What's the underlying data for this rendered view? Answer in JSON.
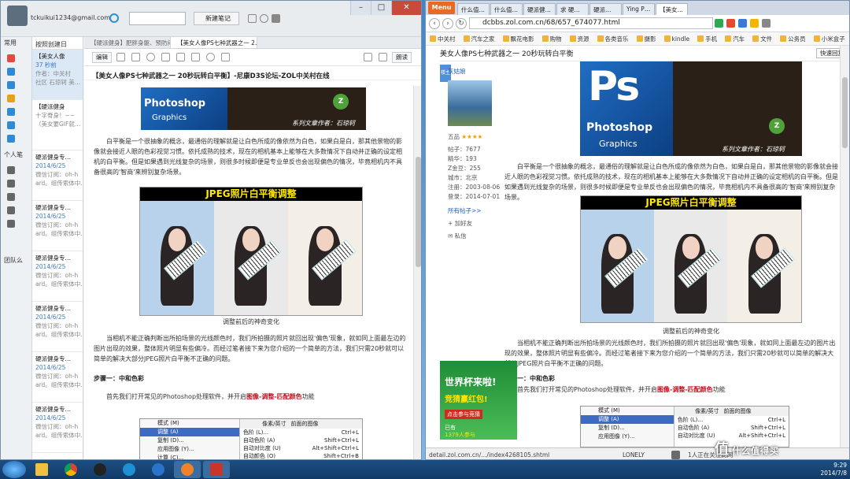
{
  "note_app": {
    "account": "tckuikui1234@gmail.com",
    "new_note_label": "新建笔记",
    "sidebar_labels": [
      "常用",
      "个人笔",
      "团队么"
    ],
    "list_header": "按照创建日",
    "list_items": [
      {
        "title": "【美女人像",
        "date": "37 秒前",
        "snip1": "作者：中关村",
        "snip2": "社区 石琼轲 美…"
      },
      {
        "title": "【硬派健身",
        "date": "十字脊身！~~",
        "snip1": "（美女要GIF就…",
        "snip2": ""
      },
      {
        "title": "硬派健身专…",
        "date": "2014/6/25",
        "snip1": "微信订阅：oh-h",
        "snip2": "ard。组传索体中…"
      },
      {
        "title": "硬派健身专…",
        "date": "2014/6/25",
        "snip1": "微信订阅：oh-h",
        "snip2": "ard。组传索体中…"
      },
      {
        "title": "硬派健身专…",
        "date": "2014/6/25",
        "snip1": "微信订阅：oh-h",
        "snip2": "ard。组传索体中…"
      },
      {
        "title": "硬派健身专…",
        "date": "2014/6/25",
        "snip1": "微信订阅：oh-h",
        "snip2": "ard。组传索体中…"
      },
      {
        "title": "硬派健身专…",
        "date": "2014/6/25",
        "snip1": "微信订阅：oh-h",
        "snip2": "ard。组传索体中…"
      },
      {
        "title": "硬派健身专…",
        "date": "2014/6/25",
        "snip1": "微信订阅：oh-h",
        "snip2": "ard。组传索体中…"
      }
    ],
    "tabs": [
      "【硬派健身】肥胖身躯、预防闷…",
      "【美女人像PS七种武器之一 2…"
    ],
    "toolbar": {
      "edit": "编辑",
      "read": "朗读"
    },
    "note_title": "【美女人像PS七种武器之一 20秒玩转白平衡】-尼康D3S论坛-ZOL中关村在线",
    "article": {
      "banner_caption": "系列文章作者：石琼轲",
      "banner_ps": "Photoshop",
      "banner_graphics": "Graphics",
      "para1": "白平衡是一个很抽象的概念，最通俗的理解就是让白色所成的像依然为白色，如果白是白，那其他景物的影像就会接近人眼的色彩视觉习惯。依托成熟的技术，现在的相机基本上能够在大多数情况下自动并正确的设定相机的白平衡。但是如果遇到光线复杂的场景，则很多时候即便是专业单反也会出现偏色的情况，毕竟相机内不具备很高的'智商'来辨别复杂场景。",
      "jpeg_title": "JPEG照片白平衡调整",
      "photo_caption": "调整前后的神奇变化",
      "para2": "当相机不能正确判断出所拍场景的光线颜色时，我们所拍摄的照片就回出现'偏色'现象，就如同上面最左边的图片出现的效果，整体照片明显有些偏冷。而经过笔者接下来为您介绍的一个简单的方法，我们只需20秒就可以简单的解决大部分JPEG照片白平衡不正确的问题。",
      "step1": "步骤一：中和色彩",
      "para3_a": "首先我们打开常见的Photoshop处理软件，并开启",
      "para3_red": "图像-调整-匹配颜色",
      "para3_b": "功能",
      "menu_items": [
        "模式 (M)",
        "调整 (A)",
        "复制 (D)...",
        "应用图像 (Y)...",
        "计算 (C)..."
      ],
      "submenu_items": [
        "色阶 (L)...",
        "自动色阶 (A)",
        "自动对比度 (U)",
        "自动颜色 (O)"
      ],
      "submenu_shortcuts": [
        "Ctrl+L",
        "Shift+Ctrl+L",
        "Alt+Shift+Ctrl+L",
        "Shift+Ctrl+B"
      ],
      "menu_tabs": [
        "像素/英寸",
        "前面的图像"
      ]
    }
  },
  "browser": {
    "menu_label": "Menu",
    "tabs": [
      "什么值…",
      "什么值…",
      "硬派健…",
      "求 硬…",
      "硬派…",
      "Ying P…",
      "【美女…"
    ],
    "url": "dcbbs.zol.com.cn/68/657_674077.html",
    "bookmarks": [
      "中关村",
      "汽车之家",
      "飘花电影",
      "购物",
      "资源",
      "各类音乐",
      "摄影",
      "kindle",
      "手机",
      "汽车",
      "文件",
      "公务员",
      "小米盒子"
    ],
    "page_title": "美女人像PS七种武器之一 20秒玩转白平衡",
    "quick_reply": "快速回复",
    "user": {
      "badge": "楼主",
      "name": "灰姑娘",
      "rank": "五品",
      "stats": [
        "帖子：7677",
        "精华：193",
        "Z金豆：255",
        "城市：北京",
        "注册：2003-08-06",
        "登录：2014-07-01"
      ],
      "all_posts": "所有帖子>>",
      "add_friend": "加好友",
      "private_msg": "私信"
    },
    "ad": {
      "line1": "世界杯来啦!",
      "line2": "竞猜赢红包!",
      "line3": "点击参与竞猜",
      "line4": "已有",
      "line5": "1379人参与"
    },
    "status_url": "detail.zol.com.cn/.../index4268105.shtml",
    "status_song": "LONELY",
    "status_online": "1人正在关注此网"
  },
  "taskbar": {
    "time": "9:29",
    "date": "2014/7/8"
  },
  "watermark": {
    "text": "值",
    "site": "什么值得买"
  }
}
